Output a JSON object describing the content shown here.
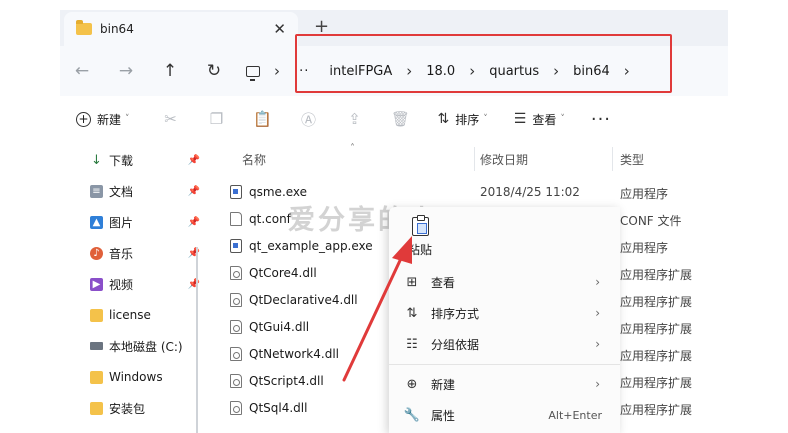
{
  "tab": {
    "title": "bin64",
    "close": "✕",
    "new": "+"
  },
  "address": {
    "back": "←",
    "forward": "→",
    "up": "↑",
    "refresh": "↻",
    "sep": "›",
    "crumbs": [
      "···",
      "intelFPGA",
      "18.0",
      "quartus",
      "bin64"
    ]
  },
  "toolbar": {
    "new_label": "新建",
    "sort_label": "排序",
    "view_label": "查看",
    "more": "···"
  },
  "sidebar": {
    "items": [
      {
        "label": "下载",
        "icon": "download-icon",
        "pinned": true
      },
      {
        "label": "文档",
        "icon": "document-icon",
        "pinned": true
      },
      {
        "label": "图片",
        "icon": "picture-icon",
        "pinned": true
      },
      {
        "label": "音乐",
        "icon": "music-icon",
        "pinned": true
      },
      {
        "label": "视频",
        "icon": "video-icon",
        "pinned": true
      },
      {
        "label": "license",
        "icon": "folder-icon",
        "pinned": false
      },
      {
        "label": "本地磁盘 (C:)",
        "icon": "drive-icon",
        "pinned": false
      },
      {
        "label": "Windows",
        "icon": "folder-icon",
        "pinned": false
      },
      {
        "label": "安装包",
        "icon": "folder-icon",
        "pinned": false
      }
    ]
  },
  "columns": {
    "name": "名称",
    "date": "修改日期",
    "type": "类型"
  },
  "files": [
    {
      "name": "qsme.exe",
      "date": "2018/4/25 11:02",
      "type": "应用程序",
      "kind": "exe"
    },
    {
      "name": "qt.conf",
      "date": "",
      "type": "CONF 文件",
      "kind": "doc"
    },
    {
      "name": "qt_example_app.exe",
      "date": "",
      "type": "应用程序",
      "kind": "exe"
    },
    {
      "name": "QtCore4.dll",
      "date": "",
      "type": "应用程序扩展",
      "kind": "dll"
    },
    {
      "name": "QtDeclarative4.dll",
      "date": "",
      "type": "应用程序扩展",
      "kind": "dll"
    },
    {
      "name": "QtGui4.dll",
      "date": "",
      "type": "应用程序扩展",
      "kind": "dll"
    },
    {
      "name": "QtNetwork4.dll",
      "date": "",
      "type": "应用程序扩展",
      "kind": "dll"
    },
    {
      "name": "QtScript4.dll",
      "date": "",
      "type": "应用程序扩展",
      "kind": "dll"
    },
    {
      "name": "QtSql4.dll",
      "date": "",
      "type": "应用程序扩展",
      "kind": "dll"
    }
  ],
  "watermark": "爱分享的小王",
  "context_menu": {
    "paste": "粘贴",
    "items": [
      {
        "label": "查看",
        "icon": "grid-icon",
        "arrow": "›"
      },
      {
        "label": "排序方式",
        "icon": "sort-icon",
        "arrow": "›"
      },
      {
        "label": "分组依据",
        "icon": "group-icon",
        "arrow": "›"
      },
      {
        "label": "新建",
        "icon": "plus-circle-icon",
        "arrow": "›"
      },
      {
        "label": "属性",
        "icon": "wrench-icon",
        "shortcut": "Alt+Enter"
      }
    ]
  },
  "colors": {
    "annotation": "#e03a3a",
    "folder": "#f4c24a"
  }
}
